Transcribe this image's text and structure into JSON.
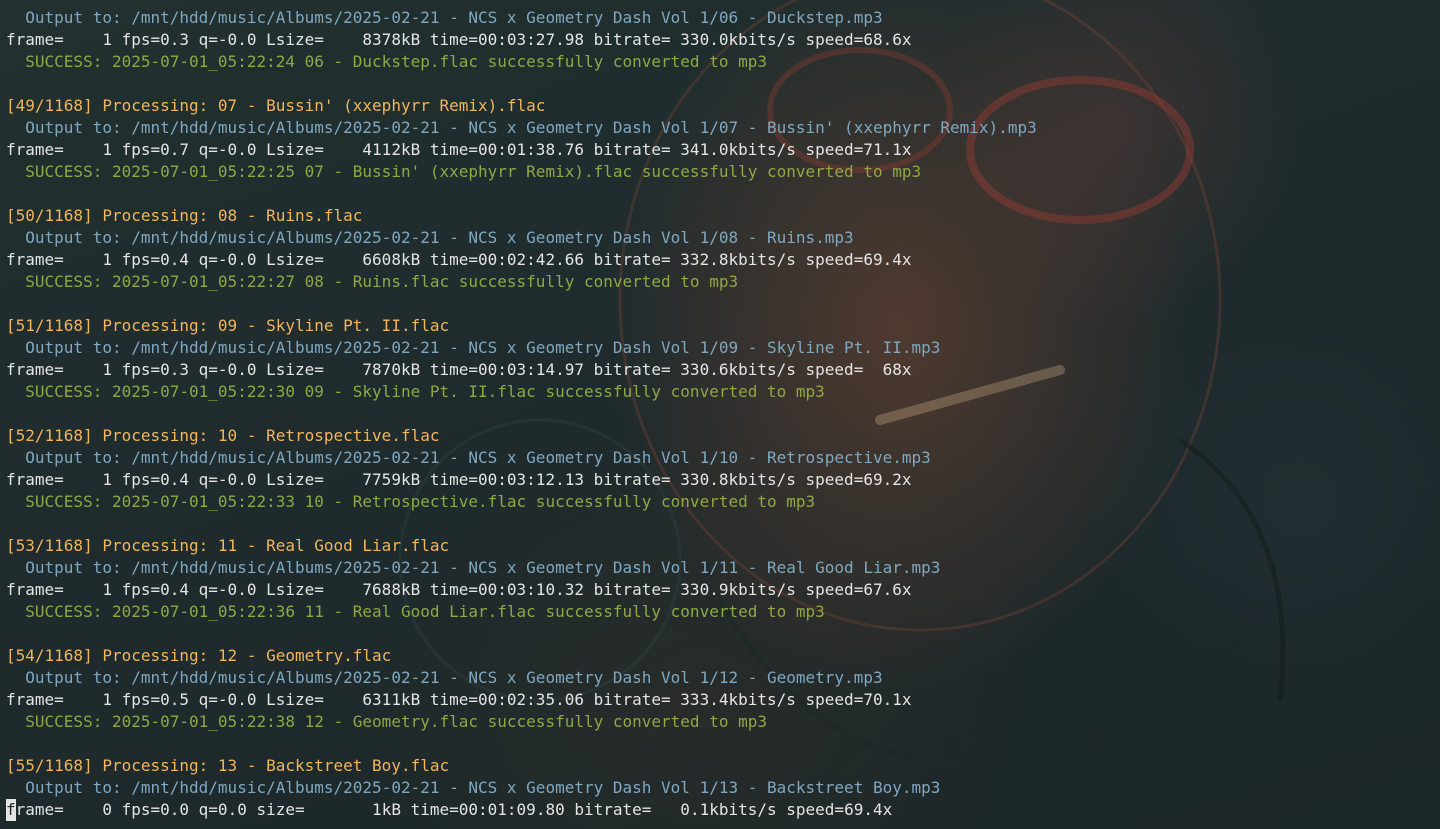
{
  "terminal": {
    "colors": {
      "processing": "#f2b55a",
      "output": "#7fa8c0",
      "frame": "#e4e4e4",
      "success": "#8fa845"
    },
    "lines": [
      {
        "type": "output",
        "text": "  Output to: /mnt/hdd/music/Albums/2025-02-21 - NCS x Geometry Dash Vol 1/06 - Duckstep.mp3"
      },
      {
        "type": "frame",
        "text": "frame=    1 fps=0.3 q=-0.0 Lsize=    8378kB time=00:03:27.98 bitrate= 330.0kbits/s speed=68.6x"
      },
      {
        "type": "success",
        "text": "  SUCCESS: 2025-07-01_05:22:24 06 - Duckstep.flac successfully converted to mp3"
      },
      {
        "type": "blank",
        "text": ""
      },
      {
        "type": "processing",
        "text": "[49/1168] Processing: 07 - Bussin' (xxephyrr Remix).flac"
      },
      {
        "type": "output",
        "text": "  Output to: /mnt/hdd/music/Albums/2025-02-21 - NCS x Geometry Dash Vol 1/07 - Bussin' (xxephyrr Remix).mp3"
      },
      {
        "type": "frame",
        "text": "frame=    1 fps=0.7 q=-0.0 Lsize=    4112kB time=00:01:38.76 bitrate= 341.0kbits/s speed=71.1x"
      },
      {
        "type": "success",
        "text": "  SUCCESS: 2025-07-01_05:22:25 07 - Bussin' (xxephyrr Remix).flac successfully converted to mp3"
      },
      {
        "type": "blank",
        "text": ""
      },
      {
        "type": "processing",
        "text": "[50/1168] Processing: 08 - Ruins.flac"
      },
      {
        "type": "output",
        "text": "  Output to: /mnt/hdd/music/Albums/2025-02-21 - NCS x Geometry Dash Vol 1/08 - Ruins.mp3"
      },
      {
        "type": "frame",
        "text": "frame=    1 fps=0.4 q=-0.0 Lsize=    6608kB time=00:02:42.66 bitrate= 332.8kbits/s speed=69.4x"
      },
      {
        "type": "success",
        "text": "  SUCCESS: 2025-07-01_05:22:27 08 - Ruins.flac successfully converted to mp3"
      },
      {
        "type": "blank",
        "text": ""
      },
      {
        "type": "processing",
        "text": "[51/1168] Processing: 09 - Skyline Pt. II.flac"
      },
      {
        "type": "output",
        "text": "  Output to: /mnt/hdd/music/Albums/2025-02-21 - NCS x Geometry Dash Vol 1/09 - Skyline Pt. II.mp3"
      },
      {
        "type": "frame",
        "text": "frame=    1 fps=0.3 q=-0.0 Lsize=    7870kB time=00:03:14.97 bitrate= 330.6kbits/s speed=  68x"
      },
      {
        "type": "success",
        "text": "  SUCCESS: 2025-07-01_05:22:30 09 - Skyline Pt. II.flac successfully converted to mp3"
      },
      {
        "type": "blank",
        "text": ""
      },
      {
        "type": "processing",
        "text": "[52/1168] Processing: 10 - Retrospective.flac"
      },
      {
        "type": "output",
        "text": "  Output to: /mnt/hdd/music/Albums/2025-02-21 - NCS x Geometry Dash Vol 1/10 - Retrospective.mp3"
      },
      {
        "type": "frame",
        "text": "frame=    1 fps=0.4 q=-0.0 Lsize=    7759kB time=00:03:12.13 bitrate= 330.8kbits/s speed=69.2x"
      },
      {
        "type": "success",
        "text": "  SUCCESS: 2025-07-01_05:22:33 10 - Retrospective.flac successfully converted to mp3"
      },
      {
        "type": "blank",
        "text": ""
      },
      {
        "type": "processing",
        "text": "[53/1168] Processing: 11 - Real Good Liar.flac"
      },
      {
        "type": "output",
        "text": "  Output to: /mnt/hdd/music/Albums/2025-02-21 - NCS x Geometry Dash Vol 1/11 - Real Good Liar.mp3"
      },
      {
        "type": "frame",
        "text": "frame=    1 fps=0.4 q=-0.0 Lsize=    7688kB time=00:03:10.32 bitrate= 330.9kbits/s speed=67.6x"
      },
      {
        "type": "success",
        "text": "  SUCCESS: 2025-07-01_05:22:36 11 - Real Good Liar.flac successfully converted to mp3"
      },
      {
        "type": "blank",
        "text": ""
      },
      {
        "type": "processing",
        "text": "[54/1168] Processing: 12 - Geometry.flac"
      },
      {
        "type": "output",
        "text": "  Output to: /mnt/hdd/music/Albums/2025-02-21 - NCS x Geometry Dash Vol 1/12 - Geometry.mp3"
      },
      {
        "type": "frame",
        "text": "frame=    1 fps=0.5 q=-0.0 Lsize=    6311kB time=00:02:35.06 bitrate= 333.4kbits/s speed=70.1x"
      },
      {
        "type": "success",
        "text": "  SUCCESS: 2025-07-01_05:22:38 12 - Geometry.flac successfully converted to mp3"
      },
      {
        "type": "blank",
        "text": ""
      },
      {
        "type": "processing",
        "text": "[55/1168] Processing: 13 - Backstreet Boy.flac"
      },
      {
        "type": "output",
        "text": "  Output to: /mnt/hdd/music/Albums/2025-02-21 - NCS x Geometry Dash Vol 1/13 - Backstreet Boy.mp3"
      }
    ],
    "last_line": {
      "cursor_char": "f",
      "rest": "rame=    0 fps=0.0 q=0.0 size=       1kB time=00:01:09.80 bitrate=   0.1kbits/s speed=69.4x"
    }
  }
}
